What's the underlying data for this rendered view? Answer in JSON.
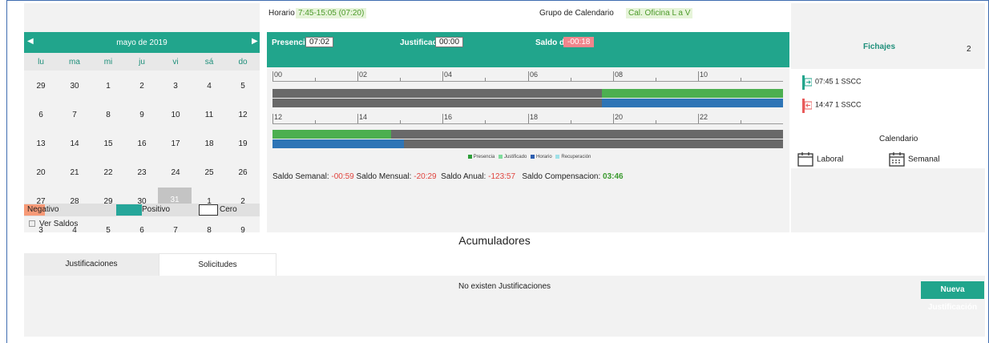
{
  "calendar": {
    "prev_icon": "caret-left-icon",
    "next_icon": "caret-right-icon",
    "month_label": "mayo de 2019",
    "weekdays": [
      "lu",
      "ma",
      "mi",
      "ju",
      "vi",
      "sá",
      "do"
    ],
    "weeks": [
      [
        "29",
        "30",
        "1",
        "2",
        "3",
        "4",
        "5"
      ],
      [
        "6",
        "7",
        "8",
        "9",
        "10",
        "11",
        "12"
      ],
      [
        "13",
        "14",
        "15",
        "16",
        "17",
        "18",
        "19"
      ],
      [
        "20",
        "21",
        "22",
        "23",
        "24",
        "25",
        "26"
      ],
      [
        "27",
        "28",
        "29",
        "30",
        "31",
        "1",
        "2"
      ],
      [
        "3",
        "4",
        "5",
        "6",
        "7",
        "8",
        "9"
      ]
    ],
    "legend": {
      "negative": "Negativo",
      "positive": "Positivo",
      "zero": "Cero"
    },
    "ver_saldos": "Ver Saldos"
  },
  "schedule": {
    "horario_label": "Horario",
    "horario_value": "7:45-15:05 (07:20)",
    "grupo_label": "Grupo de Calendario",
    "grupo_value": "Cal. Oficina L a V"
  },
  "summary": {
    "presencia_label": "Presencia:",
    "presencia_value": "07:02",
    "justificado_label": "Justificado:",
    "justificado_value": "00:00",
    "saldo_dia_label": "Saldo día:",
    "saldo_dia_value": "-00:18"
  },
  "timeline": {
    "ruler1": [
      "00",
      "02",
      "04",
      "06",
      "08",
      "10"
    ],
    "ruler2": [
      "12",
      "14",
      "16",
      "18",
      "20",
      "22"
    ],
    "legend": [
      "Presencia",
      "Justificado",
      "Horario",
      "Recuperación"
    ]
  },
  "saldos": {
    "semanal_label": "Saldo Semanal:",
    "semanal_value": "-00:59",
    "mensual_label": "Saldo Mensual:",
    "mensual_value": "-20:29",
    "anual_label": "Saldo Anual:",
    "anual_value": "-123:57",
    "compensacion_label": "Saldo Compensacion:",
    "compensacion_value": "03:46"
  },
  "fichajes": {
    "title": "Fichajes",
    "count": "2",
    "entries": [
      "07:45 1 SSCC",
      "14:47 1 SSCC"
    ],
    "calendar_title": "Calendario",
    "laboral": "Laboral",
    "semanal": "Semanal"
  },
  "acumuladores": {
    "title": "Acumuladores",
    "tab_justificaciones": "Justificaciones",
    "tab_solicitudes": "Solicitudes",
    "empty_text": "No existen Justificaciones",
    "new_button": "Nueva Justificación"
  },
  "colors": {
    "teal": "#21a58c",
    "presencia": "#4caf50",
    "horario": "#2e75b6",
    "negative": "#f79a77",
    "positive": "#26a69a"
  }
}
